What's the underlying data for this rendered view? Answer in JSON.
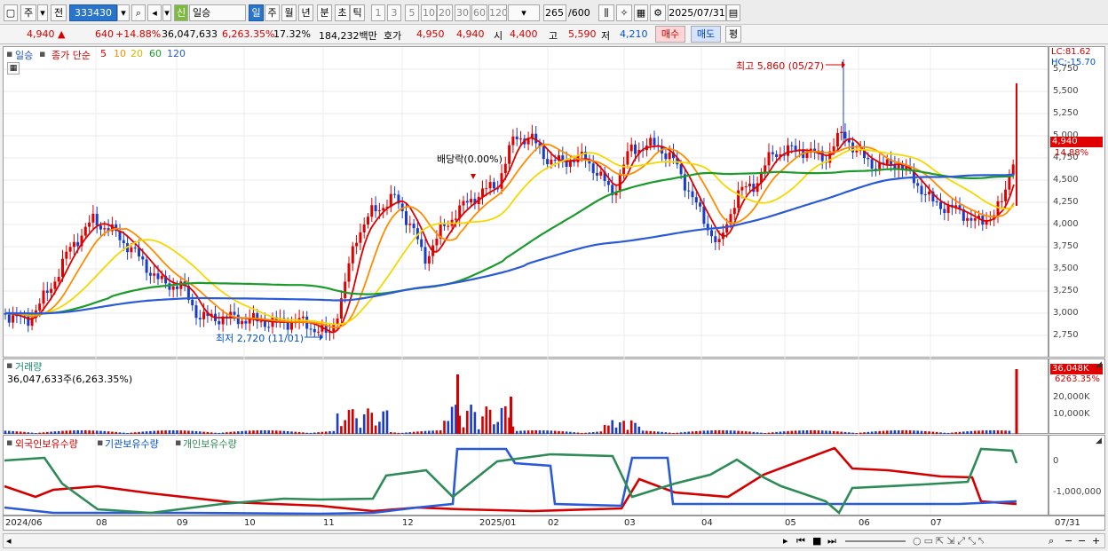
{
  "toolbar": {
    "market": "주",
    "scope": "전",
    "code": "333430",
    "badge_new": "신",
    "stock_name": "일승",
    "periods": [
      "일",
      "주",
      "월",
      "년",
      "분",
      "초",
      "틱"
    ],
    "active_period": "일",
    "intervals": [
      "1",
      "3",
      "5",
      "10",
      "20",
      "30",
      "60",
      "120"
    ],
    "count": "265",
    "count_total": "/600",
    "date": "2025/07/31"
  },
  "quote": {
    "price": "4,940",
    "arrow": "▲",
    "change": "640",
    "change_pct": "+14.88%",
    "volume": "36,047,633",
    "volume_pct": "6,263.35%",
    "turnover": "17.32%",
    "amount": "184,232백만",
    "ask_label": "호가",
    "ask1": "4,950",
    "ask2": "4,940",
    "open_label": "시",
    "open": "4,400",
    "high_label": "고",
    "high": "5,590",
    "low_label": "저",
    "low": "4,210",
    "buy": "매수",
    "sell": "매도",
    "avg": "평"
  },
  "price_pane": {
    "name": "일승",
    "ma_label": "종가 단순",
    "ma_periods": [
      "5",
      "10",
      "20",
      "60",
      "120"
    ],
    "ma_colors": [
      "#e00000",
      "#ff8c00",
      "#f5d800",
      "#1c9a2c",
      "#2a5ad8"
    ],
    "lc": "LC:81.62",
    "hc": "HC:-15.70",
    "current_price": "4,940",
    "current_pct": "14.88%",
    "max_note": "최고 5,860 (05/27)",
    "min_note": "최저 2,720 (11/01)",
    "dividend_note": "배당락(0.00%)",
    "y_ticks": [
      "5,750",
      "5,500",
      "5,250",
      "5,000",
      "4,750",
      "4,500",
      "4,250",
      "4,000",
      "3,750",
      "3,500",
      "3,250",
      "3,000",
      "2,750"
    ]
  },
  "volume_pane": {
    "title": "거래량",
    "value": "36,047,633주(6,263.35%)",
    "tag": "36,048K",
    "tag_pct": "6263.35%",
    "y_ticks": [
      "20,000K",
      "10,000K"
    ]
  },
  "holding_pane": {
    "s1": "외국인보유수량",
    "s2": "기관보유수량",
    "s3": "개인보유수량",
    "colors": [
      "#d40000",
      "#2a5ad8",
      "#2e8b57"
    ],
    "y_ticks": [
      "0",
      "-1,000,000"
    ]
  },
  "x_axis": [
    "2024/06",
    "08",
    "09",
    "10",
    "11",
    "12",
    "2025/01",
    "02",
    "03",
    "04",
    "05",
    "06",
    "07",
    "07/31"
  ]
}
